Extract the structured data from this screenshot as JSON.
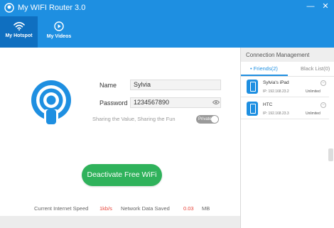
{
  "window": {
    "title": "My WIFI Router 3.0",
    "minimize_glyph": "—",
    "close_glyph": "✕"
  },
  "nav": {
    "tabs": [
      {
        "label": "My Hotspot",
        "icon": "wifi-icon",
        "active": true
      },
      {
        "label": "My Videos",
        "icon": "play-circle-icon",
        "active": false
      }
    ]
  },
  "hotspot": {
    "name_label": "Name",
    "name_value": "Sylvia",
    "password_label": "Password",
    "password_value": "1234567890",
    "sharing_text": "Sharing the Value, Sharing the Fun",
    "toggle_label": "Private",
    "deactivate_label": "Deactivate Free WiFi"
  },
  "stats": {
    "speed_label": "Current Internet Speed",
    "speed_value": "1kb/s",
    "saved_label": "Network Data Saved",
    "saved_value": "0.03",
    "saved_unit": "MB"
  },
  "connections": {
    "title": "Connection Management",
    "friends_tab": "Friends(2)",
    "blacklist_tab": "Black List(0)",
    "devices": [
      {
        "name": "Sylvia's iPad",
        "ip": "IP: 192.168.23.2",
        "limit": "Unlimited"
      },
      {
        "name": "HTC",
        "ip": "IP: 192.168.23.3",
        "limit": "Unlimited"
      }
    ]
  },
  "colors": {
    "brand_blue": "#1e8fe1",
    "active_tab_blue": "#0f6fc0",
    "button_green": "#2fb25b",
    "stat_red": "#e8443a"
  }
}
